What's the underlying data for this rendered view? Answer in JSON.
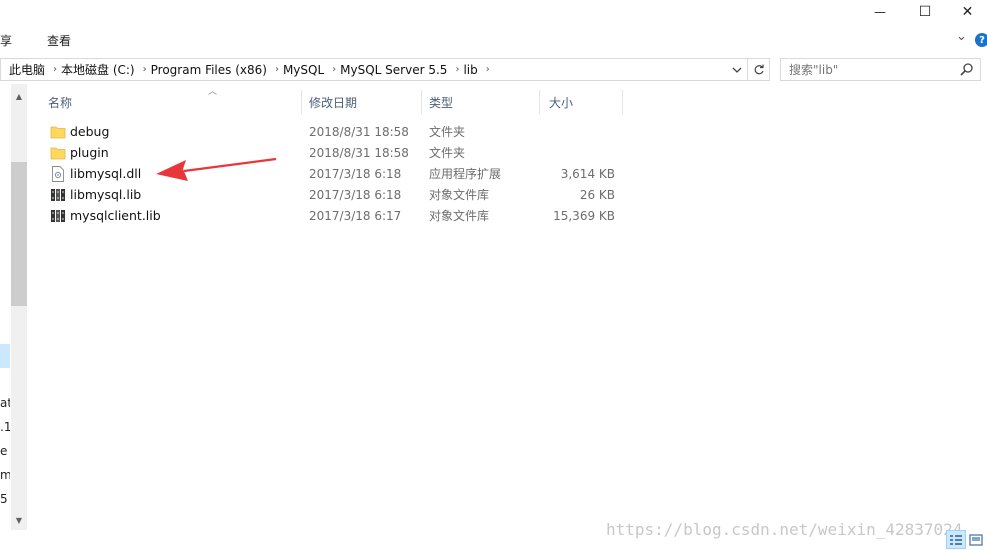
{
  "window": {
    "minimize_glyph": "—",
    "maximize_glyph": "☐",
    "close_glyph": "✕"
  },
  "ribbon": {
    "tabs": [
      "共享",
      "查看"
    ],
    "expand_glyph": "⌄",
    "help_glyph": "?"
  },
  "address": {
    "breadcrumbs": [
      "此电脑",
      "本地磁盘 (C:)",
      "Program Files (x86)",
      "MySQL",
      "MySQL Server 5.5",
      "lib"
    ],
    "separator": "›",
    "search_placeholder": "搜索\"lib\""
  },
  "nav_fragments": [
    "ati",
    ".1",
    "e",
    "mp",
    "5"
  ],
  "columns": {
    "name": "名称",
    "date": "修改日期",
    "type": "类型",
    "size": "大小"
  },
  "files": [
    {
      "name": "debug",
      "date": "2018/8/31 18:58",
      "type": "文件夹",
      "size": "",
      "icon": "folder-icon"
    },
    {
      "name": "plugin",
      "date": "2018/8/31 18:58",
      "type": "文件夹",
      "size": "",
      "icon": "folder-icon"
    },
    {
      "name": "libmysql.dll",
      "date": "2017/3/18 6:18",
      "type": "应用程序扩展",
      "size": "3,614 KB",
      "icon": "dll-file-icon"
    },
    {
      "name": "libmysql.lib",
      "date": "2017/3/18 6:18",
      "type": "对象文件库",
      "size": "26 KB",
      "icon": "library-file-icon"
    },
    {
      "name": "mysqlclient.lib",
      "date": "2017/3/18 6:17",
      "type": "对象文件库",
      "size": "15,369 KB",
      "icon": "library-file-icon"
    }
  ],
  "watermark": "https://blog.csdn.net/weixin_42837024",
  "colors": {
    "folder": "#ffd75e",
    "arrow": "#e8363a",
    "selection": "#cce8ff",
    "header_text": "#4c607a"
  }
}
